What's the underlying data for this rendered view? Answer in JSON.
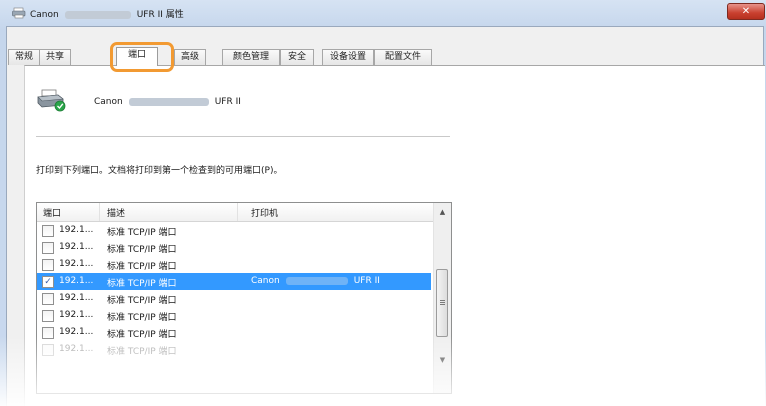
{
  "window": {
    "title_prefix": "Canon",
    "title_suffix": "UFR II 属性",
    "close_glyph": "✕"
  },
  "tabs": [
    {
      "label": "常规",
      "active": false
    },
    {
      "label": "共享",
      "active": false
    },
    {
      "label": "端口",
      "active": true
    },
    {
      "label": "高级",
      "active": false
    },
    {
      "label": "颜色管理",
      "active": false
    },
    {
      "label": "安全",
      "active": false
    },
    {
      "label": "设备设置",
      "active": false
    },
    {
      "label": "配置文件",
      "active": false
    }
  ],
  "printer": {
    "name_prefix": "Canon",
    "name_suffix": "UFR II",
    "icon": "printer-default-icon"
  },
  "instruction": "打印到下列端口。文档将打印到第一个检查到的可用端口(P)。",
  "ports": {
    "headers": [
      "端口",
      "描述",
      "打印机"
    ],
    "rows": [
      {
        "port": "192.1...",
        "description": "标准 TCP/IP 端口",
        "checked": false,
        "printer_prefix": "",
        "printer_suffix": ""
      },
      {
        "port": "192.1...",
        "description": "标准 TCP/IP 端口",
        "checked": false,
        "printer_prefix": "",
        "printer_suffix": ""
      },
      {
        "port": "192.1...",
        "description": "标准 TCP/IP 端口",
        "checked": false,
        "printer_prefix": "",
        "printer_suffix": ""
      },
      {
        "port": "192.1...",
        "description": "标准 TCP/IP 端口",
        "checked": true,
        "printer_prefix": "Canon",
        "printer_suffix": "UFR II"
      },
      {
        "port": "192.1...",
        "description": "标准 TCP/IP 端口",
        "checked": false,
        "printer_prefix": "",
        "printer_suffix": ""
      },
      {
        "port": "192.1...",
        "description": "标准 TCP/IP 端口",
        "checked": false,
        "printer_prefix": "",
        "printer_suffix": ""
      },
      {
        "port": "192.1...",
        "description": "标准 TCP/IP 端口",
        "checked": false,
        "printer_prefix": "",
        "printer_suffix": ""
      },
      {
        "port": "192.1...",
        "description": "标准 TCP/IP 端口",
        "checked": false,
        "printer_prefix": "",
        "printer_suffix": ""
      }
    ],
    "check_glyph": "✓",
    "scroll_up_glyph": "▲",
    "scroll_down_glyph": "▼",
    "selection_color": "#3399ff"
  },
  "colors": {
    "highlight": "#f29a32"
  }
}
